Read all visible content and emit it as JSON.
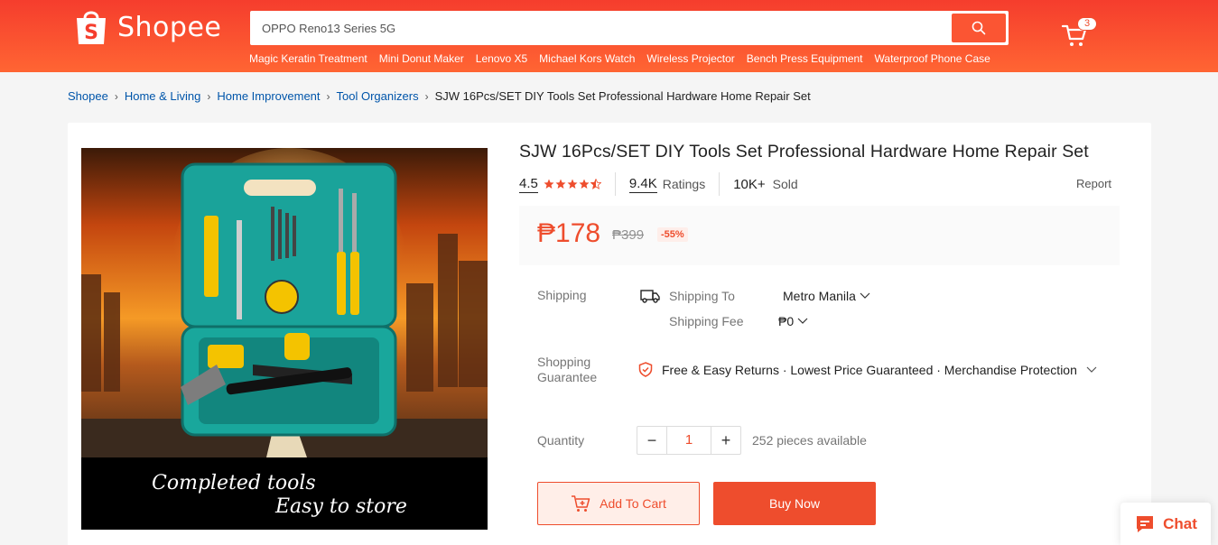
{
  "brand": {
    "name": "Shopee",
    "accent": "#ee4d2d"
  },
  "search": {
    "value": "OPPO Reno13 Series 5G",
    "placeholder": ""
  },
  "suggestions": [
    "Magic Keratin Treatment",
    "Mini Donut Maker",
    "Lenovo X5",
    "Michael Kors Watch",
    "Wireless Projector",
    "Bench Press Equipment",
    "Waterproof Phone Case"
  ],
  "cart": {
    "count": "3"
  },
  "breadcrumb": {
    "items": [
      "Shopee",
      "Home & Living",
      "Home Improvement",
      "Tool Organizers"
    ],
    "current": "SJW 16Pcs/SET DIY Tools Set Professional Hardware Home Repair Set"
  },
  "product": {
    "title": "SJW 16Pcs/SET DIY Tools Set Professional Hardware Home Repair Set",
    "rating": "4.5",
    "stars": 4.5,
    "ratings_count": "9.4K",
    "ratings_label": "Ratings",
    "sold_count": "10K+",
    "sold_label": "Sold",
    "report": "Report",
    "price": "₱178",
    "old_price": "₱399",
    "discount": "-55%",
    "image_caption_1": "Completed tools",
    "image_caption_2": "Easy to store"
  },
  "shipping": {
    "label": "Shipping",
    "to_label": "Shipping To",
    "to_value": "Metro Manila",
    "fee_label": "Shipping Fee",
    "fee_value": "₱0"
  },
  "guarantee": {
    "label_1": "Shopping",
    "label_2": "Guarantee",
    "text": "Free & Easy Returns · Lowest Price Guaranteed · Merchandise Protection"
  },
  "quantity": {
    "label": "Quantity",
    "minus": "−",
    "value": "1",
    "plus": "+",
    "available": "252 pieces available"
  },
  "actions": {
    "add_to_cart": "Add To Cart",
    "buy_now": "Buy Now"
  },
  "chat": {
    "label": "Chat"
  }
}
